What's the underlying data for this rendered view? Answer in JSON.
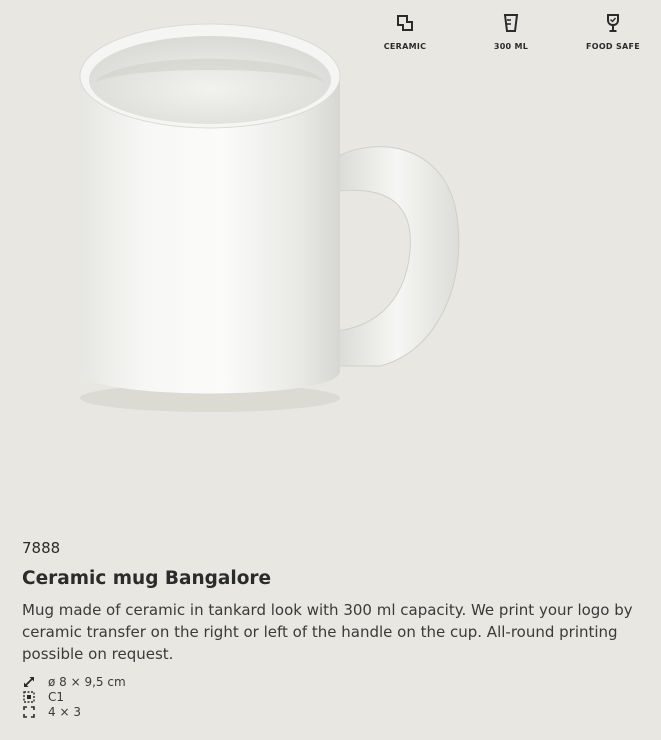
{
  "features": [
    {
      "icon": "ceramic-material-icon",
      "label": "CERAMIC"
    },
    {
      "icon": "capacity-cup-icon",
      "label": "300 ML"
    },
    {
      "icon": "food-safe-glass-icon",
      "label": "FOOD SAFE"
    }
  ],
  "product": {
    "sku": "7888",
    "title": "Ceramic mug Bangalore",
    "description": "Mug made of ceramic in tankard look with 300 ml capacity. We print your logo by ceramic transfer on the right or left of the handle on the cup. All-round printing possible on request."
  },
  "specs": [
    {
      "icon": "dimensions-icon",
      "text": "ø 8 × 9,5 cm"
    },
    {
      "icon": "print-method-icon",
      "text": "C1"
    },
    {
      "icon": "print-area-icon",
      "text": "4 × 3"
    }
  ],
  "colors": {
    "background": "#e8e7e1",
    "text": "#2b2b2b",
    "mug": "#f4f4f2"
  }
}
